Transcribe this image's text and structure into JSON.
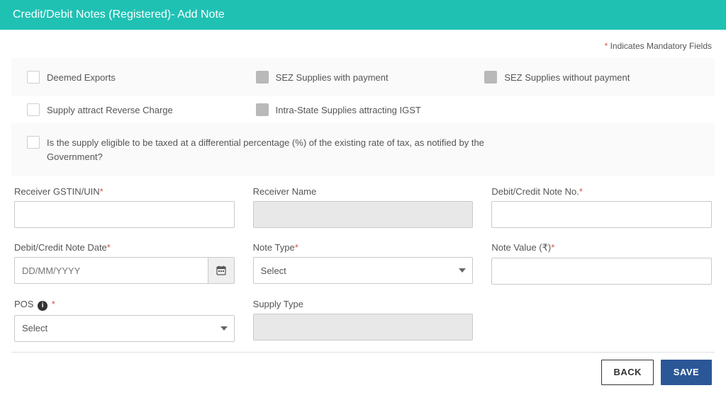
{
  "header": {
    "title": "Credit/Debit Notes (Registered)- Add Note"
  },
  "hint": {
    "star": "*",
    "text": " Indicates Mandatory Fields"
  },
  "checkboxes": {
    "deemed_exports": "Deemed Exports",
    "sez_with_payment": "SEZ Supplies with payment",
    "sez_without_payment": "SEZ Supplies without payment",
    "reverse_charge": "Supply attract Reverse Charge",
    "intra_state_igst": "Intra-State Supplies attracting IGST",
    "differential_text": "Is the supply eligible to be taxed at a differential percentage (%) of the existing rate of tax, as notified by the Government?"
  },
  "fields": {
    "receiver_gstin": {
      "label": "Receiver GSTIN/UIN",
      "value": ""
    },
    "receiver_name": {
      "label": "Receiver Name",
      "value": ""
    },
    "note_no": {
      "label": "Debit/Credit Note No.",
      "value": ""
    },
    "note_date": {
      "label": "Debit/Credit Note Date",
      "placeholder": "DD/MM/YYYY",
      "value": ""
    },
    "note_type": {
      "label": "Note Type",
      "selected": "Select"
    },
    "note_value": {
      "label": "Note Value (₹)",
      "value": ""
    },
    "pos": {
      "label": "POS ",
      "selected": "Select"
    },
    "supply_type": {
      "label": "Supply Type",
      "value": ""
    }
  },
  "buttons": {
    "back": "BACK",
    "save": "SAVE"
  }
}
